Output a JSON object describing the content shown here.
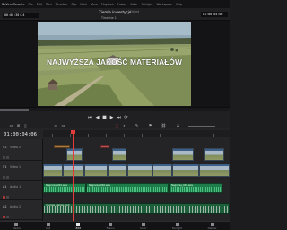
{
  "menu": {
    "app": "DaVinci Resolve",
    "items": [
      "File",
      "Edit",
      "Trim",
      "Timeline",
      "Clip",
      "Mark",
      "View",
      "Playback",
      "Fusion",
      "Color",
      "Fairlight",
      "Workspace",
      "Help"
    ]
  },
  "toolbar": {
    "timecode_left": "00:00:30:24",
    "project_title": "Ziemia inwestycje",
    "edited": "Edited",
    "timeline_name": "Timeline 1",
    "timecode_right": "01:00:04:06"
  },
  "viewer": {
    "headline": "NAJWYŻSZA JAKOŚĆ MATERIAŁÓW"
  },
  "transport": {
    "controls": [
      "⏮",
      "◀",
      "■",
      "▶",
      "⏭",
      "⟳"
    ],
    "tools": [
      "▭",
      "⊞",
      "▯",
      "▭",
      "▭",
      "⬚",
      "⌕",
      "✎",
      "⚑",
      "⛓",
      "⎍"
    ],
    "active_tool_index": 5
  },
  "timeline": {
    "timecode": "01:00:04:06",
    "tracks": [
      {
        "id": "V2",
        "label": "Video 2"
      },
      {
        "id": "V1",
        "label": "Video 1"
      },
      {
        "id": "A1",
        "label": "Audio 1"
      },
      {
        "id": "A2",
        "label": "Audio 2"
      }
    ],
    "audio_clip_labels": [
      "Nagranie_001.wav",
      "Nagranie_002.wav",
      "Nagranie_003.wav"
    ],
    "music_clip_label": "muzyka_ziemia.mp3"
  },
  "pages": [
    {
      "label": "Media",
      "active": false
    },
    {
      "label": "Cut",
      "active": false
    },
    {
      "label": "Edit",
      "active": true
    },
    {
      "label": "Fusion",
      "active": false
    },
    {
      "label": "Color",
      "active": false
    },
    {
      "label": "Fairlight",
      "active": false
    },
    {
      "label": "Deliver",
      "active": false
    }
  ],
  "colors": {
    "playhead": "#e03b3b",
    "video_clip": "#6d8aa6",
    "audio_clip": "#1e7d4a"
  }
}
